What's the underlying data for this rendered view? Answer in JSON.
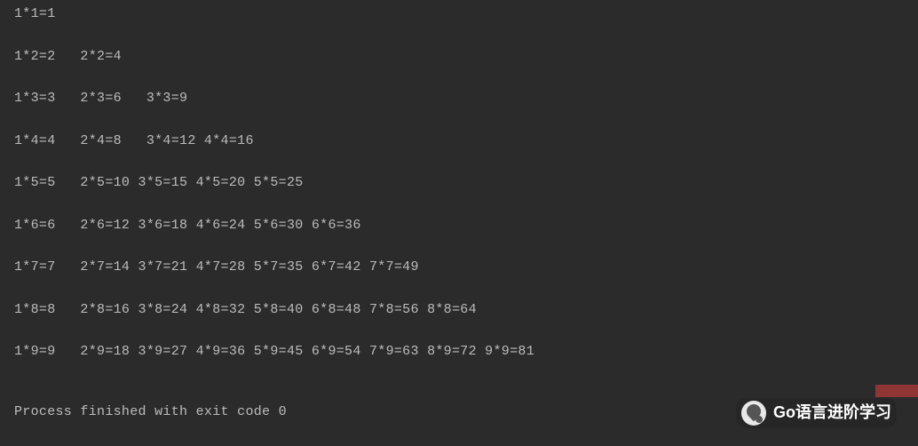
{
  "output": {
    "lines": [
      "1*1=1",
      "1*2=2   2*2=4",
      "1*3=3   2*3=6   3*3=9",
      "1*4=4   2*4=8   3*4=12 4*4=16",
      "1*5=5   2*5=10 3*5=15 4*5=20 5*5=25",
      "1*6=6   2*6=12 3*6=18 4*6=24 5*6=30 6*6=36",
      "1*7=7   2*7=14 3*7=21 4*7=28 5*7=35 6*7=42 7*7=49",
      "1*8=8   2*8=16 3*8=24 4*8=32 5*8=40 6*8=48 7*8=56 8*8=64",
      "1*9=9   2*9=18 3*9=27 4*9=36 5*9=45 6*9=54 7*9=63 8*9=72 9*9=81"
    ],
    "process_finished": "Process finished with exit code 0"
  },
  "watermark": {
    "text": "Go语言进阶学习"
  },
  "chart_data": {
    "type": "table",
    "title": "Multiplication Table 1-9",
    "rows": [
      [
        {
          "a": 1,
          "b": 1,
          "r": 1
        }
      ],
      [
        {
          "a": 1,
          "b": 2,
          "r": 2
        },
        {
          "a": 2,
          "b": 2,
          "r": 4
        }
      ],
      [
        {
          "a": 1,
          "b": 3,
          "r": 3
        },
        {
          "a": 2,
          "b": 3,
          "r": 6
        },
        {
          "a": 3,
          "b": 3,
          "r": 9
        }
      ],
      [
        {
          "a": 1,
          "b": 4,
          "r": 4
        },
        {
          "a": 2,
          "b": 4,
          "r": 8
        },
        {
          "a": 3,
          "b": 4,
          "r": 12
        },
        {
          "a": 4,
          "b": 4,
          "r": 16
        }
      ],
      [
        {
          "a": 1,
          "b": 5,
          "r": 5
        },
        {
          "a": 2,
          "b": 5,
          "r": 10
        },
        {
          "a": 3,
          "b": 5,
          "r": 15
        },
        {
          "a": 4,
          "b": 5,
          "r": 20
        },
        {
          "a": 5,
          "b": 5,
          "r": 25
        }
      ],
      [
        {
          "a": 1,
          "b": 6,
          "r": 6
        },
        {
          "a": 2,
          "b": 6,
          "r": 12
        },
        {
          "a": 3,
          "b": 6,
          "r": 18
        },
        {
          "a": 4,
          "b": 6,
          "r": 24
        },
        {
          "a": 5,
          "b": 6,
          "r": 30
        },
        {
          "a": 6,
          "b": 6,
          "r": 36
        }
      ],
      [
        {
          "a": 1,
          "b": 7,
          "r": 7
        },
        {
          "a": 2,
          "b": 7,
          "r": 14
        },
        {
          "a": 3,
          "b": 7,
          "r": 21
        },
        {
          "a": 4,
          "b": 7,
          "r": 28
        },
        {
          "a": 5,
          "b": 7,
          "r": 35
        },
        {
          "a": 6,
          "b": 7,
          "r": 42
        },
        {
          "a": 7,
          "b": 7,
          "r": 49
        }
      ],
      [
        {
          "a": 1,
          "b": 8,
          "r": 8
        },
        {
          "a": 2,
          "b": 8,
          "r": 16
        },
        {
          "a": 3,
          "b": 8,
          "r": 24
        },
        {
          "a": 4,
          "b": 8,
          "r": 32
        },
        {
          "a": 5,
          "b": 8,
          "r": 40
        },
        {
          "a": 6,
          "b": 8,
          "r": 48
        },
        {
          "a": 7,
          "b": 8,
          "r": 56
        },
        {
          "a": 8,
          "b": 8,
          "r": 64
        }
      ],
      [
        {
          "a": 1,
          "b": 9,
          "r": 9
        },
        {
          "a": 2,
          "b": 9,
          "r": 18
        },
        {
          "a": 3,
          "b": 9,
          "r": 27
        },
        {
          "a": 4,
          "b": 9,
          "r": 36
        },
        {
          "a": 5,
          "b": 9,
          "r": 45
        },
        {
          "a": 6,
          "b": 9,
          "r": 54
        },
        {
          "a": 7,
          "b": 9,
          "r": 63
        },
        {
          "a": 8,
          "b": 9,
          "r": 72
        },
        {
          "a": 9,
          "b": 9,
          "r": 81
        }
      ]
    ]
  }
}
